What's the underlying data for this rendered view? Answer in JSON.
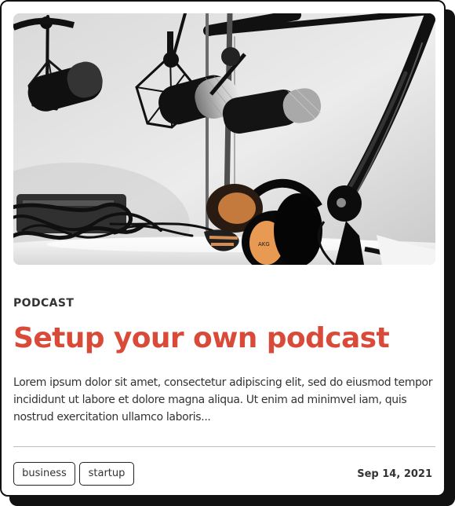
{
  "card": {
    "image": {
      "subject": "podcast studio microphones and headphones",
      "brand_text": "AKG"
    },
    "category": "PODCAST",
    "title": "Setup your own podcast",
    "excerpt": "Lorem ipsum dolor sit amet, consectetur adipiscing elit, sed do eiusmod tempor incididunt ut labore et dolore magna aliqua. Ut enim ad minimvel iam, quis nostrud exercitation ullamco laboris...",
    "tags": [
      "business",
      "startup"
    ],
    "date": "Sep 14, 2021"
  },
  "colors": {
    "accent": "#d94a38",
    "text": "#333333",
    "border": "#111111",
    "divider": "#bdbdbd",
    "background": "#ffffff"
  }
}
